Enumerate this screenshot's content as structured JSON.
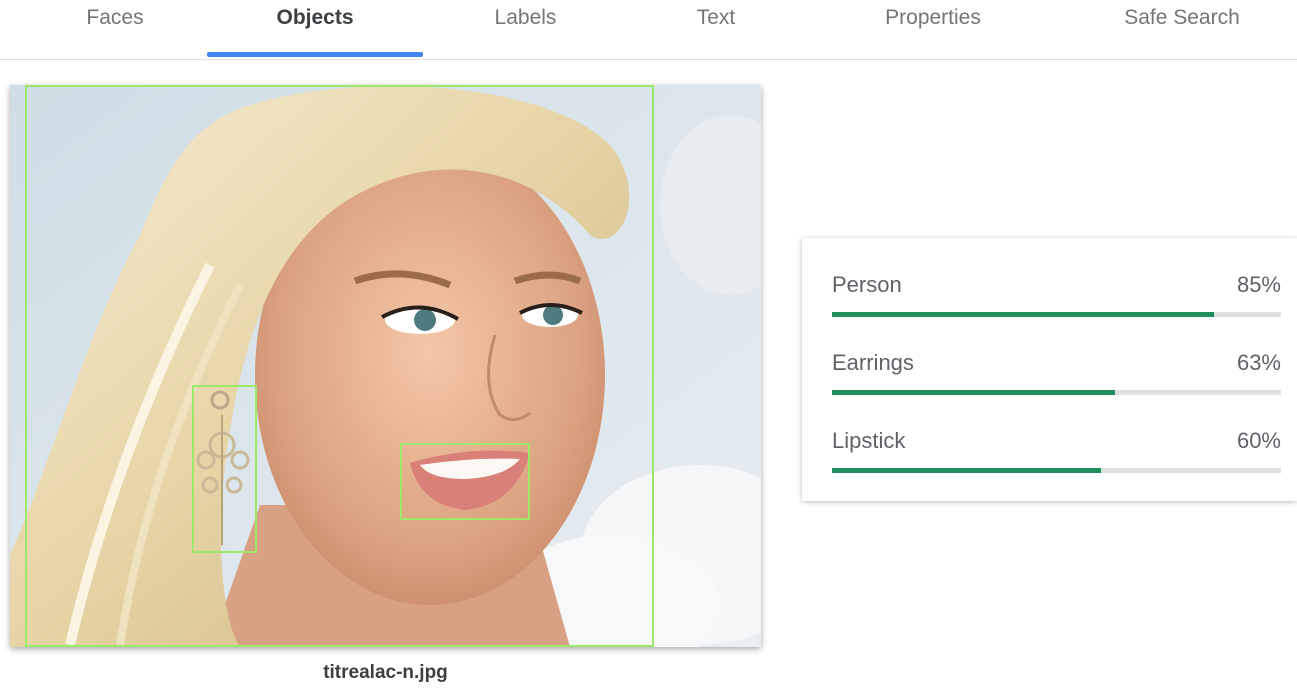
{
  "tabs": [
    {
      "label": "Faces",
      "active": false
    },
    {
      "label": "Objects",
      "active": true
    },
    {
      "label": "Labels",
      "active": false
    },
    {
      "label": "Text",
      "active": false
    },
    {
      "label": "Properties",
      "active": false
    },
    {
      "label": "Safe Search",
      "active": false
    }
  ],
  "image": {
    "filename": "titrealac-n.jpg",
    "detections": [
      "Person",
      "Earrings",
      "Lipstick"
    ]
  },
  "results": [
    {
      "label": "Person",
      "percent_text": "85%",
      "score": 0.85
    },
    {
      "label": "Earrings",
      "percent_text": "63%",
      "score": 0.63
    },
    {
      "label": "Lipstick",
      "percent_text": "60%",
      "score": 0.6
    }
  ],
  "colors": {
    "accent": "#4285f4",
    "bar_fill": "#1e8e5a",
    "bar_track": "#e0e0e0",
    "bbox": "#9be86a"
  }
}
